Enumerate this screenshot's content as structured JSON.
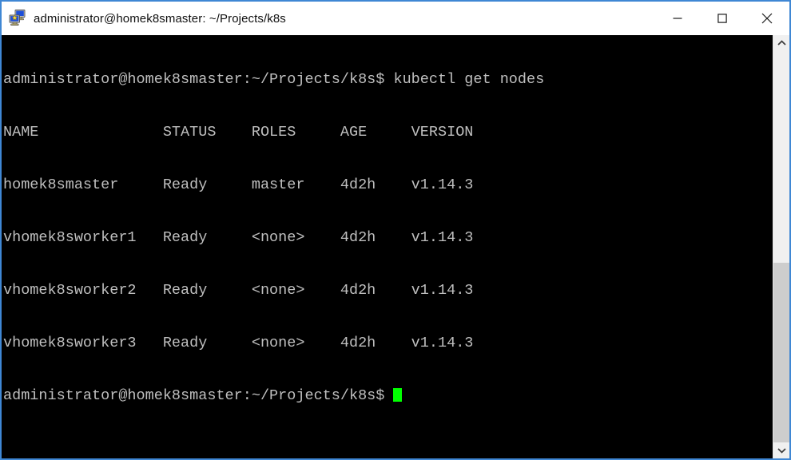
{
  "window": {
    "title": "administrator@homek8smaster: ~/Projects/k8s",
    "icon": "putty-icon",
    "border_color": "#3f87d4",
    "titlebar_bg": "#ffffff",
    "controls": {
      "minimize_label": "—",
      "maximize_label": "□",
      "close_label": "✕"
    }
  },
  "terminal": {
    "background_color": "#000000",
    "foreground_color": "#bfbfbf",
    "cursor_color": "#00ff00",
    "font_size_px": 18.5,
    "lines": [
      "administrator@homek8smaster:~/Projects/k8s$ kubectl get nodes",
      "NAME              STATUS    ROLES     AGE     VERSION",
      "homek8smaster     Ready     master    4d2h    v1.14.3",
      "vhomek8sworker1   Ready     <none>    4d2h    v1.14.3",
      "vhomek8sworker2   Ready     <none>    4d2h    v1.14.3",
      "vhomek8sworker3   Ready     <none>    4d2h    v1.14.3"
    ],
    "prompt": "administrator@homek8smaster:~/Projects/k8s$ ",
    "command": "kubectl get nodes",
    "table": {
      "headers": [
        "NAME",
        "STATUS",
        "ROLES",
        "AGE",
        "VERSION"
      ],
      "rows": [
        {
          "name": "homek8smaster",
          "status": "Ready",
          "roles": "master",
          "age": "4d2h",
          "version": "v1.14.3"
        },
        {
          "name": "vhomek8sworker1",
          "status": "Ready",
          "roles": "<none>",
          "age": "4d2h",
          "version": "v1.14.3"
        },
        {
          "name": "vhomek8sworker2",
          "status": "Ready",
          "roles": "<none>",
          "age": "4d2h",
          "version": "v1.14.3"
        },
        {
          "name": "vhomek8sworker3",
          "status": "Ready",
          "roles": "<none>",
          "age": "4d2h",
          "version": "v1.14.3"
        }
      ]
    }
  },
  "scrollbar": {
    "up_arrow": "⌃",
    "down_arrow": "⌄",
    "thumb_top_percent": 54,
    "track_color": "#f0f0f0",
    "thumb_color": "#cdcdcd"
  }
}
